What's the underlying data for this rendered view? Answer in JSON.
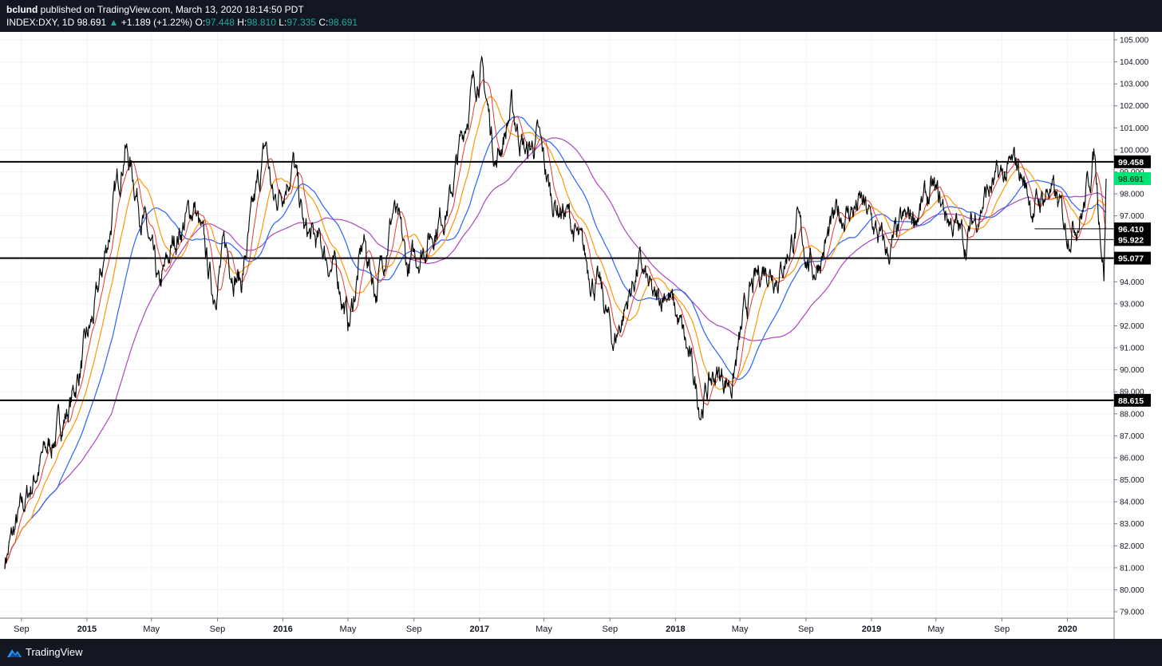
{
  "header": {
    "publisher": "bclund",
    "published_text": "published on TradingView.com, March 13, 2020 18:14:50 PDT",
    "symbol": "INDEX:DXY, 1D",
    "last": "98.691",
    "change": "+1.189 (+1.22%)",
    "o_label": "O:",
    "o": "97.448",
    "h_label": "H:",
    "h": "98.810",
    "l_label": "L:",
    "l": "97.335",
    "c_label": "C:",
    "c": "98.691"
  },
  "footer": {
    "brand": "TradingView"
  },
  "colors": {
    "price": "#000000",
    "ma_red": "#e53935",
    "ma_orange": "#ff9800",
    "ma_blue": "#2962ff",
    "ma_purple": "#ab47bc",
    "last_price_bg": "#00e676"
  },
  "chart_data": {
    "type": "line",
    "ylim": [
      79,
      105
    ],
    "y_ticks": [
      "105.000",
      "104.000",
      "103.000",
      "102.000",
      "101.000",
      "100.000",
      "99.000",
      "98.000",
      "97.000",
      "96.000",
      "95.000",
      "94.000",
      "93.000",
      "92.000",
      "91.000",
      "90.000",
      "89.000",
      "88.000",
      "87.000",
      "86.000",
      "85.000",
      "84.000",
      "83.000",
      "82.000",
      "81.000",
      "80.000",
      "79.000"
    ],
    "x_ticks": [
      "Sep",
      "2015",
      "May",
      "Sep",
      "2016",
      "May",
      "Sep",
      "2017",
      "May",
      "Sep",
      "2018",
      "May",
      "Sep",
      "2019",
      "May",
      "Sep",
      "2020"
    ],
    "x_tick_dates": [
      "2014-09-01",
      "2015-01-01",
      "2015-05-01",
      "2015-09-01",
      "2016-01-01",
      "2016-05-01",
      "2016-09-01",
      "2017-01-01",
      "2017-05-01",
      "2017-09-01",
      "2018-01-01",
      "2018-05-01",
      "2018-09-01",
      "2019-01-01",
      "2019-05-01",
      "2019-09-01",
      "2020-01-01"
    ],
    "x_range": [
      "2014-08-01",
      "2020-03-13"
    ],
    "grid": true,
    "horizontal_levels": [
      {
        "value": 99.458,
        "label": "99.458"
      },
      {
        "value": 95.077,
        "label": "95.077"
      },
      {
        "value": 88.615,
        "label": "88.615"
      },
      {
        "value": 96.41,
        "label": "96.410",
        "start": "2019-11-01"
      },
      {
        "value": 95.922,
        "label": "95.922",
        "start": "2019-02-01"
      }
    ],
    "last_price": {
      "value": 98.691,
      "label": "98.691"
    },
    "price_anchors": [
      [
        "2014-08-01",
        81.4
      ],
      [
        "2014-10-01",
        85.5
      ],
      [
        "2014-12-01",
        88.4
      ],
      [
        "2015-01-15",
        92.5
      ],
      [
        "2015-03-13",
        100.3
      ],
      [
        "2015-04-20",
        96.5
      ],
      [
        "2015-05-15",
        93.4
      ],
      [
        "2015-06-15",
        96.0
      ],
      [
        "2015-07-20",
        97.5
      ],
      [
        "2015-08-24",
        93.5
      ],
      [
        "2015-09-15",
        95.5
      ],
      [
        "2015-10-15",
        94.0
      ],
      [
        "2015-11-30",
        100.2
      ],
      [
        "2015-12-15",
        97.5
      ],
      [
        "2016-01-20",
        99.5
      ],
      [
        "2016-02-10",
        96.2
      ],
      [
        "2016-03-15",
        95.5
      ],
      [
        "2016-04-15",
        94.0
      ],
      [
        "2016-05-03",
        92.0
      ],
      [
        "2016-05-30",
        95.8
      ],
      [
        "2016-06-23",
        93.6
      ],
      [
        "2016-07-25",
        97.4
      ],
      [
        "2016-08-20",
        94.5
      ],
      [
        "2016-09-15",
        95.5
      ],
      [
        "2016-11-08",
        97.8
      ],
      [
        "2016-12-15",
        102.5
      ],
      [
        "2017-01-03",
        103.8
      ],
      [
        "2017-02-01",
        99.5
      ],
      [
        "2017-03-01",
        101.8
      ],
      [
        "2017-03-30",
        99.8
      ],
      [
        "2017-04-20",
        100.5
      ],
      [
        "2017-05-15",
        97.8
      ],
      [
        "2017-06-15",
        97.0
      ],
      [
        "2017-07-15",
        95.0
      ],
      [
        "2017-08-15",
        93.5
      ],
      [
        "2017-09-08",
        91.2
      ],
      [
        "2017-10-25",
        94.8
      ],
      [
        "2017-11-25",
        92.8
      ],
      [
        "2017-12-15",
        93.8
      ],
      [
        "2018-01-15",
        91.5
      ],
      [
        "2018-02-16",
        88.4
      ],
      [
        "2018-03-15",
        89.8
      ],
      [
        "2018-04-17",
        89.5
      ],
      [
        "2018-05-15",
        93.0
      ],
      [
        "2018-06-15",
        94.8
      ],
      [
        "2018-07-15",
        94.5
      ],
      [
        "2018-08-15",
        96.5
      ],
      [
        "2018-09-15",
        94.5
      ],
      [
        "2018-10-31",
        97.0
      ],
      [
        "2018-12-14",
        97.5
      ],
      [
        "2019-01-31",
        95.2
      ],
      [
        "2019-03-01",
        96.5
      ],
      [
        "2019-04-25",
        98.0
      ],
      [
        "2019-06-25",
        95.8
      ],
      [
        "2019-08-01",
        98.0
      ],
      [
        "2019-09-30",
        99.3
      ],
      [
        "2019-10-31",
        97.3
      ],
      [
        "2019-11-29",
        98.3
      ],
      [
        "2019-12-31",
        96.4
      ],
      [
        "2020-01-31",
        97.4
      ],
      [
        "2020-02-20",
        99.9
      ],
      [
        "2020-03-09",
        94.7
      ],
      [
        "2020-03-13",
        98.7
      ]
    ]
  }
}
